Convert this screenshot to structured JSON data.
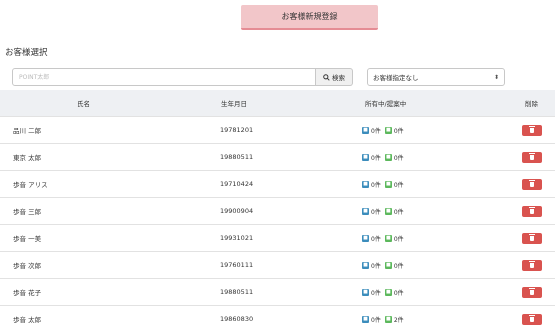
{
  "header": {
    "register_button": "お客様新規登録"
  },
  "section_title": "お客様選択",
  "search": {
    "placeholder": "POINT太郎",
    "button_label": "検索"
  },
  "filter": {
    "selected": "お客様指定なし"
  },
  "table": {
    "columns": [
      "氏名",
      "生年月日",
      "所有中/提案中",
      "削除"
    ],
    "rows": [
      {
        "name": "品川 二郎",
        "birth": "19781201",
        "own": "0件",
        "proposal": "0件"
      },
      {
        "name": "東京 太郎",
        "birth": "19880511",
        "own": "0件",
        "proposal": "0件"
      },
      {
        "name": "歩音 アリス",
        "birth": "19710424",
        "own": "0件",
        "proposal": "0件"
      },
      {
        "name": "歩音 三郎",
        "birth": "19900904",
        "own": "0件",
        "proposal": "0件"
      },
      {
        "name": "歩音 一美",
        "birth": "19931021",
        "own": "0件",
        "proposal": "0件"
      },
      {
        "name": "歩音 次郎",
        "birth": "19760111",
        "own": "0件",
        "proposal": "0件"
      },
      {
        "name": "歩音 花子",
        "birth": "19880511",
        "own": "0件",
        "proposal": "0件"
      },
      {
        "name": "歩音 太郎",
        "birth": "19860830",
        "own": "0件",
        "proposal": "2件"
      }
    ]
  },
  "colors": {
    "accent": "#f2c6c9",
    "delete": "#d9534f",
    "own_badge": "#3c8dbc",
    "proposal_badge": "#5cb85c"
  }
}
